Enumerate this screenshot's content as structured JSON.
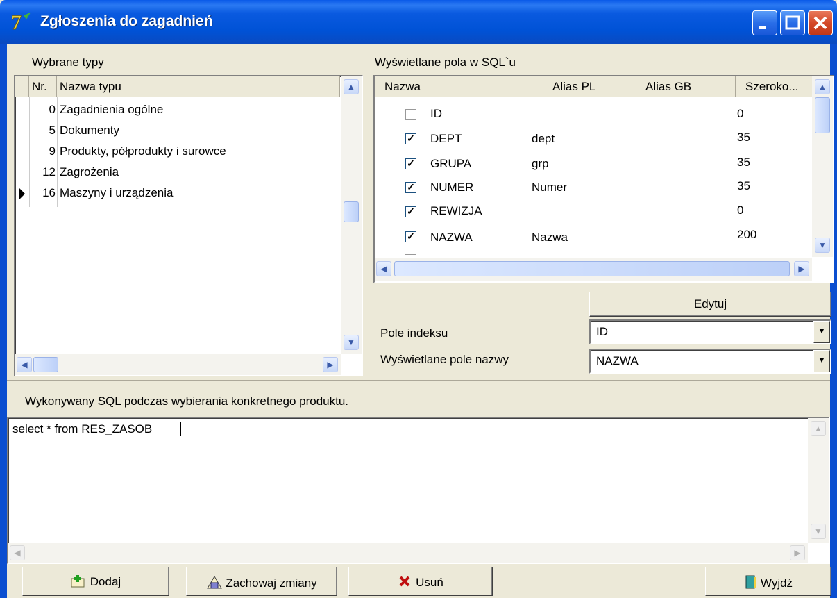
{
  "window": {
    "title": "Zgłoszenia do zagadnień"
  },
  "left": {
    "label": "Wybrane typy",
    "columns": [
      "Nr.",
      "Nazwa typu"
    ],
    "rows": [
      {
        "nr": "0",
        "name": "Zagadnienia ogólne"
      },
      {
        "nr": "5",
        "name": "Dokumenty"
      },
      {
        "nr": "9",
        "name": "Produkty, półprodukty i surowce"
      },
      {
        "nr": "12",
        "name": "Zagrożenia"
      },
      {
        "nr": "16",
        "name": "Maszyny i urządzenia"
      }
    ]
  },
  "right": {
    "label": "Wyświetlane pola w SQL`u",
    "columns": [
      "Nazwa",
      "Alias PL",
      "Alias GB",
      "Szeroko..."
    ],
    "rows": [
      {
        "checked": false,
        "name": "ID",
        "alias_pl": "",
        "alias_gb": "",
        "width": "0"
      },
      {
        "checked": true,
        "name": "DEPT",
        "alias_pl": "dept",
        "alias_gb": "",
        "width": "35"
      },
      {
        "checked": true,
        "name": "GRUPA",
        "alias_pl": "grp",
        "alias_gb": "",
        "width": "35"
      },
      {
        "checked": true,
        "name": "NUMER",
        "alias_pl": "Numer",
        "alias_gb": "",
        "width": "35"
      },
      {
        "checked": true,
        "name": "REWIZJA",
        "alias_pl": "",
        "alias_gb": "",
        "width": "0"
      },
      {
        "checked": true,
        "name": "NAZWA",
        "alias_pl": "Nazwa",
        "alias_gb": "",
        "width": "200"
      }
    ],
    "edit_button": "Edytuj",
    "index_label": "Pole indeksu",
    "index_value": "ID",
    "name_label": "Wyświetlane pole nazwy",
    "name_value": "NAZWA"
  },
  "sql": {
    "label": "Wykonywany SQL podczas wybierania konkretnego produktu.",
    "text": "select * from RES_ZASOB"
  },
  "buttons": {
    "add": "Dodaj",
    "save": "Zachowaj zmiany",
    "delete": "Usuń",
    "exit": "Wyjdź"
  }
}
